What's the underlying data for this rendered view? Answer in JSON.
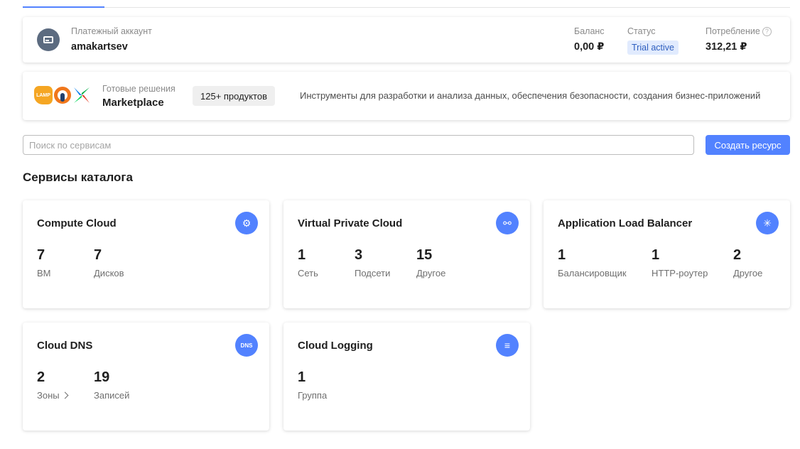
{
  "billing": {
    "account_label": "Платежный аккаунт",
    "account_name": "amakartsev",
    "balance_label": "Баланс",
    "balance_value": "0,00 ₽",
    "status_label": "Статус",
    "status_value": "Trial active",
    "consumption_label": "Потребление",
    "consumption_value": "312,21 ₽",
    "help_glyph": "?"
  },
  "marketplace": {
    "lamp_label": "LAMP",
    "subtitle": "Готовые решения",
    "title": "Marketplace",
    "count": "125+ продуктов",
    "description": "Инструменты для разработки и анализа данных, обеспечения безопасности, создания бизнес-приложений"
  },
  "search": {
    "placeholder": "Поиск по сервисам"
  },
  "create_button": "Создать ресурс",
  "section_title": "Сервисы каталога",
  "services": [
    {
      "title": "Compute Cloud",
      "icon": "gear-icon",
      "glyph": "⚙",
      "metrics": [
        {
          "value": "7",
          "label": "ВМ"
        },
        {
          "value": "7",
          "label": "Дисков"
        }
      ]
    },
    {
      "title": "Virtual Private Cloud",
      "icon": "network-icon",
      "glyph": "⚯",
      "metrics": [
        {
          "value": "1",
          "label": "Сеть"
        },
        {
          "value": "3",
          "label": "Подсети"
        },
        {
          "value": "15",
          "label": "Другое"
        }
      ]
    },
    {
      "title": "Application Load Balancer",
      "icon": "balancer-icon",
      "glyph": "✳",
      "metrics": [
        {
          "value": "1",
          "label": "Балансировщик"
        },
        {
          "value": "1",
          "label": "HTTP-роутер"
        },
        {
          "value": "2",
          "label": "Другое"
        }
      ]
    },
    {
      "title": "Cloud DNS",
      "icon": "dns-icon",
      "glyph": "DNS",
      "metrics": [
        {
          "value": "2",
          "label": "Зоны"
        },
        {
          "value": "19",
          "label": "Записей"
        }
      ]
    },
    {
      "title": "Cloud Logging",
      "icon": "logging-icon",
      "glyph": "≡",
      "metrics": [
        {
          "value": "1",
          "label": "Группа"
        }
      ]
    }
  ],
  "colors": {
    "accent": "#5282ff",
    "status_bg": "#e1ebfe"
  }
}
